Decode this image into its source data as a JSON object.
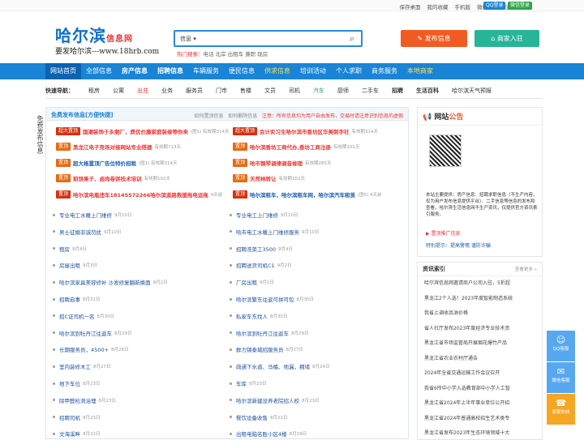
{
  "topbar": {
    "links": [
      "保存桌面",
      "我的收藏",
      "手机版",
      "微信平台",
      "注册",
      "登录"
    ],
    "qq": "QQ登录",
    "wx": "微信登录"
  },
  "logo": {
    "main": "哈尔滨",
    "sub": "信息网",
    "slogan": "要发哈尔滨---www.18hrb.com"
  },
  "search": {
    "select": "信息",
    "hot_label": "热门搜索：",
    "hot": "电话 北岸 出租车 兼职 现房"
  },
  "buttons": {
    "publish": "发布信息",
    "merchant": "商家入驻"
  },
  "nav": [
    "网站首页",
    "全部信息",
    "房产信息",
    "招聘信息",
    "车辆服务",
    "便民信息",
    "供求信息",
    "培训活动",
    "个人求职",
    "商务服务",
    "本地商家"
  ],
  "quick": {
    "label": "快速导航：",
    "items": [
      "租房",
      "公寓",
      "出兑",
      "业务",
      "服务员",
      "门市",
      "售楼",
      "文员",
      "司机",
      "汽车",
      "厨师",
      "二手车",
      "招聘",
      "生活百科",
      "哈尔滨天气预报"
    ]
  },
  "left": {
    "title": "免费发布信息[方便快捷]",
    "link1": "如何置顶信息",
    "link2": "如何删除信息",
    "warn": "注意：所有信息均为用户自由发布，交易时请注意识别信息的虚假"
  },
  "side_vertical": "免费发布信息",
  "ads": [
    {
      "badge": "超大置顶",
      "t": "国潮装饰于永丽厂，质优价廉家庭装修等你来",
      "meta": "(图1) 有效期314天",
      "cls": "t-red",
      "b": "b-top"
    },
    {
      "badge": "超大置顶",
      "t": "会计实习生哈尔滨市香坊区华美制字社",
      "meta": "有效期314天",
      "cls": "t-red",
      "b": "b-top"
    },
    {
      "badge": "置顶",
      "t": "黑龙江电子竞场对接网站专业搭建",
      "meta": "有效期713天",
      "cls": "t-red",
      "b": "b-pin"
    },
    {
      "badge": "置顶",
      "t": "哈尔滨香坊工商代办,香坊工商注册",
      "meta": "有效期101天",
      "cls": "t-red",
      "b": "b-pin"
    },
    {
      "badge": "置顶",
      "t": "超大格置顶广告位特价招租",
      "meta": "(图1) 有效期314天",
      "cls": "t-blue",
      "b": "b-pin"
    },
    {
      "badge": "置顶",
      "t": "哈市钢琴调律调音修理",
      "meta": "有效期285天",
      "cls": "t-red",
      "b": "b-pin"
    },
    {
      "badge": "置顶",
      "t": "煎饼果子、卤肉卷饼技术培训",
      "meta": "有效期102天",
      "cls": "t-red",
      "b": "b-pin"
    },
    {
      "badge": "置顶",
      "t": "天然林转让",
      "meta": "有效期102天",
      "cls": "t-red",
      "b": "b-pin"
    },
    {
      "badge": "置顶",
      "t": "哈尔滨电瓶违车18145572266哈尔滨道路救援拖电运拖",
      "meta": "4天前",
      "cls": "t-red",
      "b": "b-top"
    },
    {
      "badge": "置顶",
      "t": "哈尔滨租车，哈尔滨租车网，哈尔滨汽车租赁",
      "meta": "(图5) 4天前",
      "cls": "t-blue",
      "b": "b-top"
    }
  ],
  "list_left": [
    [
      "专业电工水暖上门维修",
      "9月10日"
    ],
    [
      "男士征婚非诚勿扰",
      "9月10日"
    ],
    [
      "租房",
      "9月4日"
    ],
    [
      "房屋出租",
      "9月3日"
    ],
    [
      "哈尔滨家具美容修补 沙发修复翻新换面",
      "9月2日"
    ],
    [
      "招聘启事",
      "8月31日"
    ],
    [
      "招C证司机一名",
      "8月30日"
    ],
    [
      "哈尔滨到牡丹江往返车",
      "8月29日"
    ],
    [
      "长期服务员，4500+",
      "8月28日"
    ],
    [
      "室内装修木工",
      "8月27日"
    ],
    [
      "地下车位",
      "8月23日"
    ],
    [
      "除甲醛检测治理",
      "8月23日"
    ],
    [
      "招聘司机",
      "8月23日"
    ],
    [
      "文海溪畔",
      "8月22日"
    ]
  ],
  "list_right": [
    [
      "专业电工上门维修",
      "9月10日"
    ],
    [
      "哈市电工水暖上门维修服务",
      "9月10日"
    ],
    [
      "招聘洗菜工3500",
      "9月4日"
    ],
    [
      "招聘送货司机C1",
      "9月2日"
    ],
    [
      "厂房出租",
      "9月1日"
    ],
    [
      "哈尔滨繁东往返可拼可包",
      "8月30日"
    ],
    [
      "私家车东找人",
      "8月30日"
    ],
    [
      "哈尔滨到牡丹江往返车",
      "8月29日"
    ],
    [
      "群力锦泰城招服务员",
      "8月27日"
    ],
    [
      "疏通下水道、马桶、地漏，拥堵",
      "8月24日"
    ],
    [
      "车库",
      "8月23日"
    ],
    [
      "哈尔滨新建设养老院招人校",
      "8月23日"
    ],
    [
      "餐饮设备收售",
      "8月22日"
    ],
    [
      "出租电脑名胜小区4楼",
      "8月19日"
    ]
  ],
  "notice": {
    "title1": "网站",
    "title2": "公告",
    "text": "本站主要提供：房产信息、招聘求职信息（不生产内容，仅为用户发布信息提供平台）、二手信息等信息的发布和查看，哈尔滨生活信息网不生产资讯，仅提供官方资讯索引服务。",
    "link1": "置顶推广信息",
    "link2": "特别提示：提高警惕 谨防诈骗"
  },
  "news": {
    "title": "资讯索引",
    "more": "查看更多 »",
    "items": [
      "哈尔滨信息网邀请商户公司入驻，5折超",
      "黑龙江2个人选！2023年度智能制造系统",
      "我省上调收品油价格",
      "省人社厅发布2023年度经济专业技术资",
      "黑龙江省市场监管局开展烟花爆竹产品",
      "黑龙江省农业农村厅通告",
      "2024年全省交通运输工作会议召开",
      "我省6所中小学入选教育部中小学人工智",
      "黑龙江省2024年上半年事业单位公开招",
      "黑龙江省2024年普通高校招生艺术类专",
      "黑龙江省发布2023年生态环境领域十大"
    ]
  },
  "float": {
    "qq": "QQ客服",
    "wx": "微信客服",
    "phone": "客服热线"
  }
}
